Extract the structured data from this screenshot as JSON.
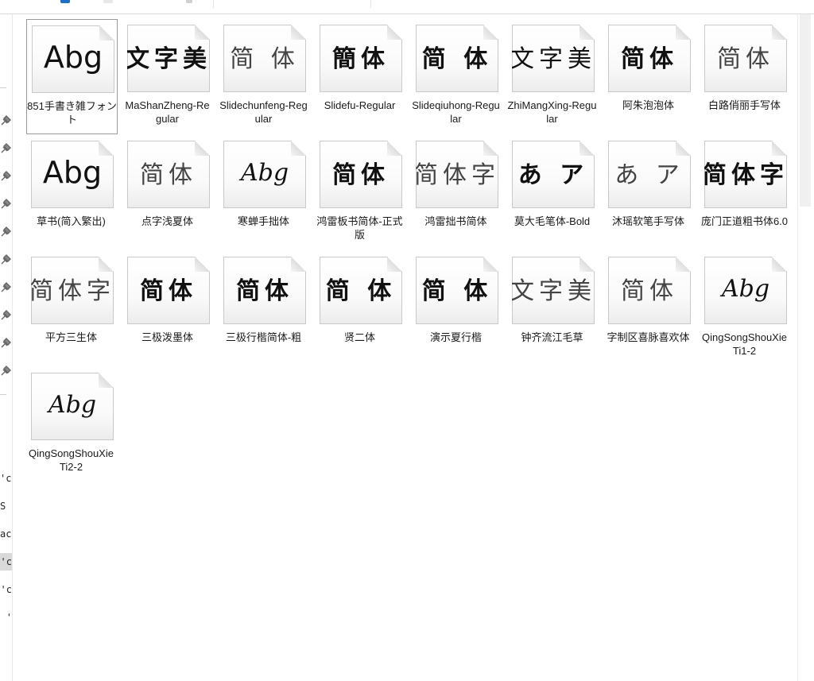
{
  "colors": {
    "accent": "#1e6fc8",
    "selection_border": "#9a9a9a",
    "nav_selected": "#d9d9d9"
  },
  "nav": {
    "pin_icon": "pin-icon",
    "partial_items": [
      "c'",
      " S",
      "ac",
      "c' (",
      "c' (",
      "' ("
    ]
  },
  "files": [
    {
      "name": "851手書き雑フォント",
      "preview": "Abg",
      "style": "latin"
    },
    {
      "name": "MaShanZheng-Regular",
      "preview": "文字美",
      "style": "cjk bold"
    },
    {
      "name": "Slidechunfeng-Regular",
      "preview": "简 体",
      "style": "cjk light"
    },
    {
      "name": "Slidefu-Regular",
      "preview": "簡体",
      "style": "cjk bold"
    },
    {
      "name": "Slideqiuhong-Regular",
      "preview": "简 体",
      "style": "cjk bold"
    },
    {
      "name": "ZhiMangXing-Regular",
      "preview": "文字美",
      "style": "cjk"
    },
    {
      "name": "阿朱泡泡体",
      "preview": "简体",
      "style": "cjk bold"
    },
    {
      "name": "白路俏丽手写体",
      "preview": "简体",
      "style": "cjk light"
    },
    {
      "name": "草书(简入繁出)",
      "preview": "Abg",
      "style": "latin"
    },
    {
      "name": "点字浅夏体",
      "preview": "简体",
      "style": "cjk light"
    },
    {
      "name": "寒蝉手拙体",
      "preview": "Abg",
      "style": "latin-hand"
    },
    {
      "name": "鸿雷板书简体-正式版",
      "preview": "简体",
      "style": "cjk bold"
    },
    {
      "name": "鸿雷拙书简体",
      "preview": "简体字",
      "style": "cjk light"
    },
    {
      "name": "莫大毛笔体-Bold",
      "preview": "あ ア",
      "style": "cjk bold"
    },
    {
      "name": "沐瑶软笔手写体",
      "preview": "あ ア",
      "style": "cjk light"
    },
    {
      "name": "庞门正道粗书体6.0",
      "preview": "简体字",
      "style": "cjk bold"
    },
    {
      "name": "平方三生体",
      "preview": "简体字",
      "style": "cjk light"
    },
    {
      "name": "三极泼墨体",
      "preview": "简体",
      "style": "cjk bold"
    },
    {
      "name": "三极行楷简体-粗",
      "preview": "简体",
      "style": "cjk bold"
    },
    {
      "name": "贤二体",
      "preview": "简 体",
      "style": "cjk bold"
    },
    {
      "name": "演示夏行楷",
      "preview": "简 体",
      "style": "cjk bold"
    },
    {
      "name": "钟齐流江毛草",
      "preview": "文字美",
      "style": "cjk light"
    },
    {
      "name": "字制区喜脉喜欢体",
      "preview": "简体",
      "style": "cjk light"
    },
    {
      "name": "QingSongShouXieTi1-2",
      "preview": "Abg",
      "style": "latin-hand"
    },
    {
      "name": "QingSongShouXieTi2-2",
      "preview": "Abg",
      "style": "latin-hand"
    }
  ]
}
